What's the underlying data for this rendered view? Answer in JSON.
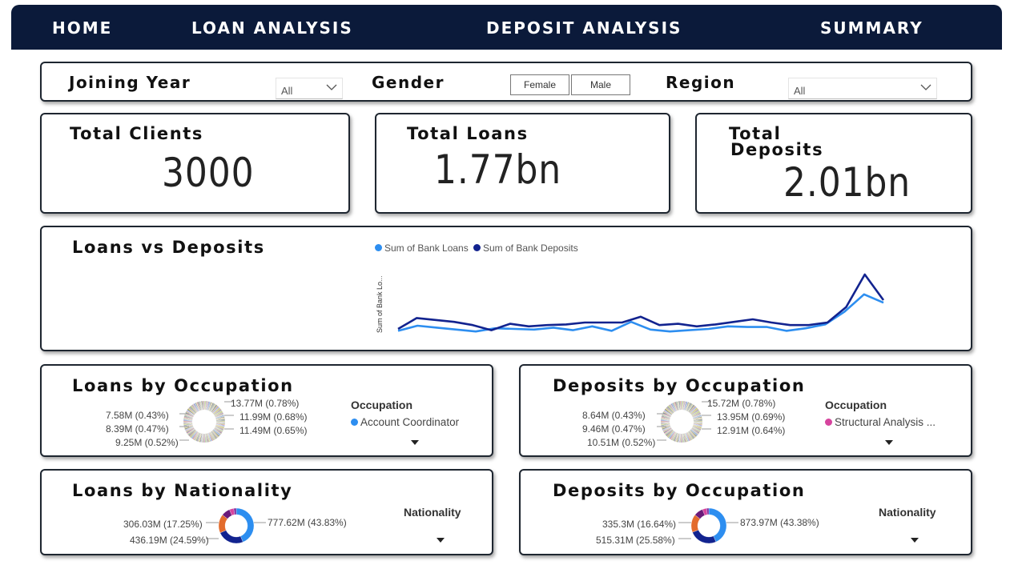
{
  "nav": {
    "home": "HOME",
    "loan_analysis": "LOAN ANALYSIS",
    "deposit_analysis": "DEPOSIT ANALYSIS",
    "summary": "SUMMARY"
  },
  "filters": {
    "joining_year_label": "Joining Year",
    "joining_year_value": "All",
    "gender_label": "Gender",
    "gender_options": [
      "Female",
      "Male"
    ],
    "region_label": "Region",
    "region_value": "All"
  },
  "kpis": {
    "total_clients_label": "Total Clients",
    "total_clients_value": "3000",
    "total_loans_label": "Total Loans",
    "total_loans_value": "1.77bn",
    "total_deposits_label_1": "Total",
    "total_deposits_label_2": "Deposits",
    "total_deposits_value": "2.01bn"
  },
  "line_chart": {
    "title": "Loans vs Deposits",
    "legend_loans": "Sum of Bank Loans",
    "legend_deposits": "Sum of Bank Deposits",
    "y_label": "Sum of Bank Lo...",
    "colors": {
      "loans": "#2d8ef0",
      "deposits": "#12238f"
    }
  },
  "chart_data": {
    "type": "line",
    "ylabel": "Sum of Bank Lo...",
    "series": [
      {
        "name": "Sum of Bank Loans",
        "values": [
          2,
          10,
          7,
          4,
          1,
          6,
          5,
          4,
          7,
          3,
          9,
          2,
          16,
          4,
          1,
          3,
          5,
          9,
          8,
          8,
          2,
          6,
          12,
          32,
          59,
          46
        ]
      },
      {
        "name": "Sum of Bank Deposits",
        "values": [
          5,
          22,
          19,
          16,
          11,
          3,
          13,
          9,
          11,
          12,
          15,
          15,
          15,
          24,
          11,
          13,
          9,
          12,
          16,
          20,
          15,
          11,
          11,
          15,
          39,
          90,
          50
        ]
      }
    ]
  },
  "loans_occ": {
    "title": "Loans by Occupation",
    "labels_left": [
      "7.58M (0.43%)",
      "8.39M (0.47%)",
      "9.25M (0.52%)"
    ],
    "labels_right": [
      "13.77M (0.78%)",
      "11.99M (0.68%)",
      "11.49M (0.65%)"
    ],
    "legend_title": "Occupation",
    "legend_entry": "Account Coordinator",
    "legend_color": "#2d8ef0"
  },
  "deposits_occ": {
    "title": "Deposits by Occupation",
    "labels_left": [
      "8.64M (0.43%)",
      "9.46M (0.47%)",
      "10.51M (0.52%)"
    ],
    "labels_right": [
      "15.72M (0.78%)",
      "13.95M (0.69%)",
      "12.91M (0.64%)"
    ],
    "legend_title": "Occupation",
    "legend_entry": "Structural Analysis ...",
    "legend_color": "#d6449e"
  },
  "loans_nat": {
    "title": "Loans by Nationality",
    "label_left_1": "306.03M (17.25%)",
    "label_left_2": "436.19M (24.59%)",
    "label_right": "777.62M (43.83%)",
    "legend_title": "Nationality",
    "donut": [
      43.83,
      24.59,
      17.25,
      8.0,
      4.0,
      2.33
    ]
  },
  "deposits_nat": {
    "title": "Deposits by Occupation",
    "label_left_1": "335.3M (16.64%)",
    "label_left_2": "515.31M (25.58%)",
    "label_right": "873.97M (43.38%)",
    "legend_title": "Nationality",
    "donut": [
      43.38,
      25.58,
      16.64,
      8.5,
      3.9,
      2.0
    ]
  }
}
